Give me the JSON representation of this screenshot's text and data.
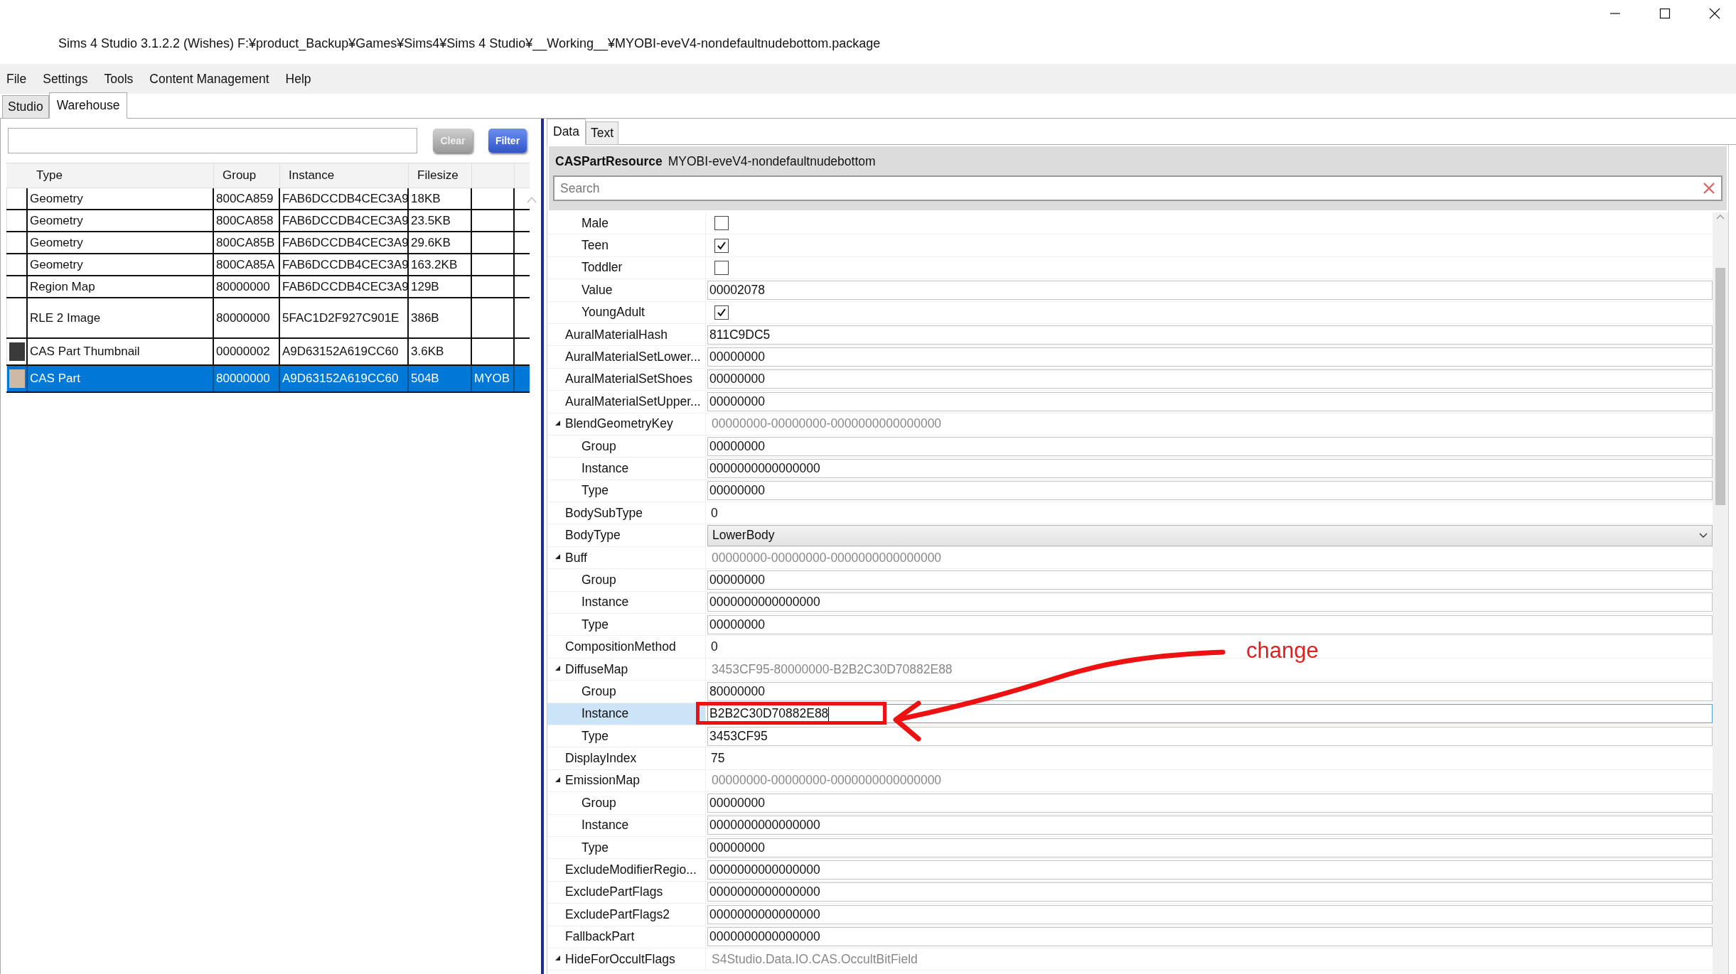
{
  "window": {
    "title": "Sims 4 Studio 3.1.2.2 (Wishes)  F:¥product_Backup¥Games¥Sims4¥Sims 4 Studio¥__Working__¥MYOBI-eveV4-nondefaultnudebottom.package"
  },
  "menu": [
    "File",
    "Settings",
    "Tools",
    "Content Management",
    "Help"
  ],
  "tabs": [
    {
      "label": "Studio",
      "selected": false
    },
    {
      "label": "Warehouse",
      "selected": true
    }
  ],
  "filter": {
    "clear_label": "Clear",
    "filter_label": "Filter"
  },
  "table": {
    "columns": [
      "Type",
      "Group",
      "Instance",
      "Filesize"
    ],
    "rows": [
      {
        "type": "Geometry",
        "group": "800CA859",
        "instance": "FAB6DCCDB4CEC3A9",
        "filesize": "18KB",
        "selected": false
      },
      {
        "type": "Geometry",
        "group": "800CA858",
        "instance": "FAB6DCCDB4CEC3A9",
        "filesize": "23.5KB",
        "selected": false
      },
      {
        "type": "Geometry",
        "group": "800CA85B",
        "instance": "FAB6DCCDB4CEC3A9",
        "filesize": "29.6KB",
        "selected": false
      },
      {
        "type": "Geometry",
        "group": "800CA85A",
        "instance": "FAB6DCCDB4CEC3A9",
        "filesize": "163.2KB",
        "selected": false
      },
      {
        "type": "Region Map",
        "group": "80000000",
        "instance": "FAB6DCCDB4CEC3A9",
        "filesize": "129B",
        "selected": false
      },
      {
        "type": "RLE 2 Image",
        "group": "80000000",
        "instance": "5FAC1D2F927C901E",
        "filesize": "386B",
        "selected": false
      },
      {
        "type": "CAS Part Thumbnail",
        "group": "00000002",
        "instance": "A9D63152A619CC60",
        "filesize": "3.6KB",
        "selected": false,
        "color": "#3a3a3a"
      },
      {
        "type": "CAS Part",
        "group": "80000000",
        "instance": "A9D63152A619CC60",
        "filesize": "504B",
        "column_5": "MYOB",
        "selected": true,
        "color": "#cdb9a6"
      }
    ]
  },
  "detail_tabs": [
    {
      "label": "Data",
      "selected": true
    },
    {
      "label": "Text",
      "selected": false
    }
  ],
  "resource": {
    "type": "CASPartResource",
    "name": "MYOBI-eveV4-nondefaultnudebottom"
  },
  "search": {
    "placeholder": "Search"
  },
  "properties": [
    {
      "kind": "continuation",
      "children": [
        {
          "name": "Male",
          "kind": "checkbox",
          "checked": false,
          "selected": false
        },
        {
          "name": "Teen",
          "kind": "checkbox",
          "checked": true,
          "selected": false
        },
        {
          "name": "Toddler",
          "kind": "checkbox",
          "checked": false,
          "selected": false
        },
        {
          "name": "Value",
          "kind": "text",
          "value": "00002078",
          "selected": false
        },
        {
          "name": "YoungAdult",
          "kind": "checkbox",
          "checked": true,
          "selected": false
        }
      ]
    },
    {
      "name": "AuralMaterialHash",
      "kind": "text",
      "value": "811C9DC5",
      "selected": false
    },
    {
      "name": "AuralMaterialSetLower...",
      "kind": "text",
      "value": "00000000",
      "selected": false
    },
    {
      "name": "AuralMaterialSetShoes",
      "kind": "text",
      "value": "00000000",
      "selected": false
    },
    {
      "name": "AuralMaterialSetUpper...",
      "kind": "text",
      "value": "00000000",
      "selected": false
    },
    {
      "name": "BlendGeometryKey",
      "kind": "group",
      "value": "00000000-00000000-0000000000000000",
      "expanded": true,
      "selected": false,
      "children": [
        {
          "name": "Group",
          "kind": "text",
          "value": "00000000",
          "selected": false
        },
        {
          "name": "Instance",
          "kind": "text",
          "value": "0000000000000000",
          "selected": false
        },
        {
          "name": "Type",
          "kind": "text",
          "value": "00000000",
          "selected": false
        }
      ]
    },
    {
      "name": "BodySubType",
      "kind": "plain",
      "value": "0",
      "selected": false
    },
    {
      "name": "BodyType",
      "kind": "dropdown",
      "value": "LowerBody",
      "selected": false
    },
    {
      "name": "Buff",
      "kind": "group",
      "value": "00000000-00000000-0000000000000000",
      "expanded": true,
      "selected": false,
      "children": [
        {
          "name": "Group",
          "kind": "text",
          "value": "00000000",
          "selected": false
        },
        {
          "name": "Instance",
          "kind": "text",
          "value": "0000000000000000",
          "selected": false
        },
        {
          "name": "Type",
          "kind": "text",
          "value": "00000000",
          "selected": false
        }
      ]
    },
    {
      "name": "CompositionMethod",
      "kind": "plain",
      "value": "0",
      "selected": false
    },
    {
      "name": "DiffuseMap",
      "kind": "group",
      "value": "3453CF95-80000000-B2B2C30D70882E88",
      "expanded": true,
      "selected": false,
      "children": [
        {
          "name": "Group",
          "kind": "text",
          "value": "80000000",
          "selected": false
        },
        {
          "name": "Instance",
          "kind": "text",
          "value": "B2B2C30D70882E88",
          "selected": true
        },
        {
          "name": "Type",
          "kind": "text",
          "value": "3453CF95",
          "selected": false
        }
      ]
    },
    {
      "name": "DisplayIndex",
      "kind": "plain",
      "value": "75",
      "selected": false
    },
    {
      "name": "EmissionMap",
      "kind": "group",
      "value": "00000000-00000000-0000000000000000",
      "expanded": true,
      "selected": false,
      "children": [
        {
          "name": "Group",
          "kind": "text",
          "value": "00000000",
          "selected": false
        },
        {
          "name": "Instance",
          "kind": "text",
          "value": "0000000000000000",
          "selected": false
        },
        {
          "name": "Type",
          "kind": "text",
          "value": "00000000",
          "selected": false
        }
      ]
    },
    {
      "name": "ExcludeModifierRegio...",
      "kind": "text",
      "value": "0000000000000000",
      "selected": false
    },
    {
      "name": "ExcludePartFlags",
      "kind": "text",
      "value": "0000000000000000",
      "selected": false
    },
    {
      "name": "ExcludePartFlags2",
      "kind": "text",
      "value": "0000000000000000",
      "selected": false
    },
    {
      "name": "FallbackPart",
      "kind": "text",
      "value": "0000000000000000",
      "selected": false
    },
    {
      "name": "HideForOccultFlags",
      "kind": "group",
      "value": "S4Studio.Data.IO.CAS.OccultBitField",
      "expanded": true,
      "selected": false
    }
  ],
  "annotation": {
    "text": "change"
  }
}
